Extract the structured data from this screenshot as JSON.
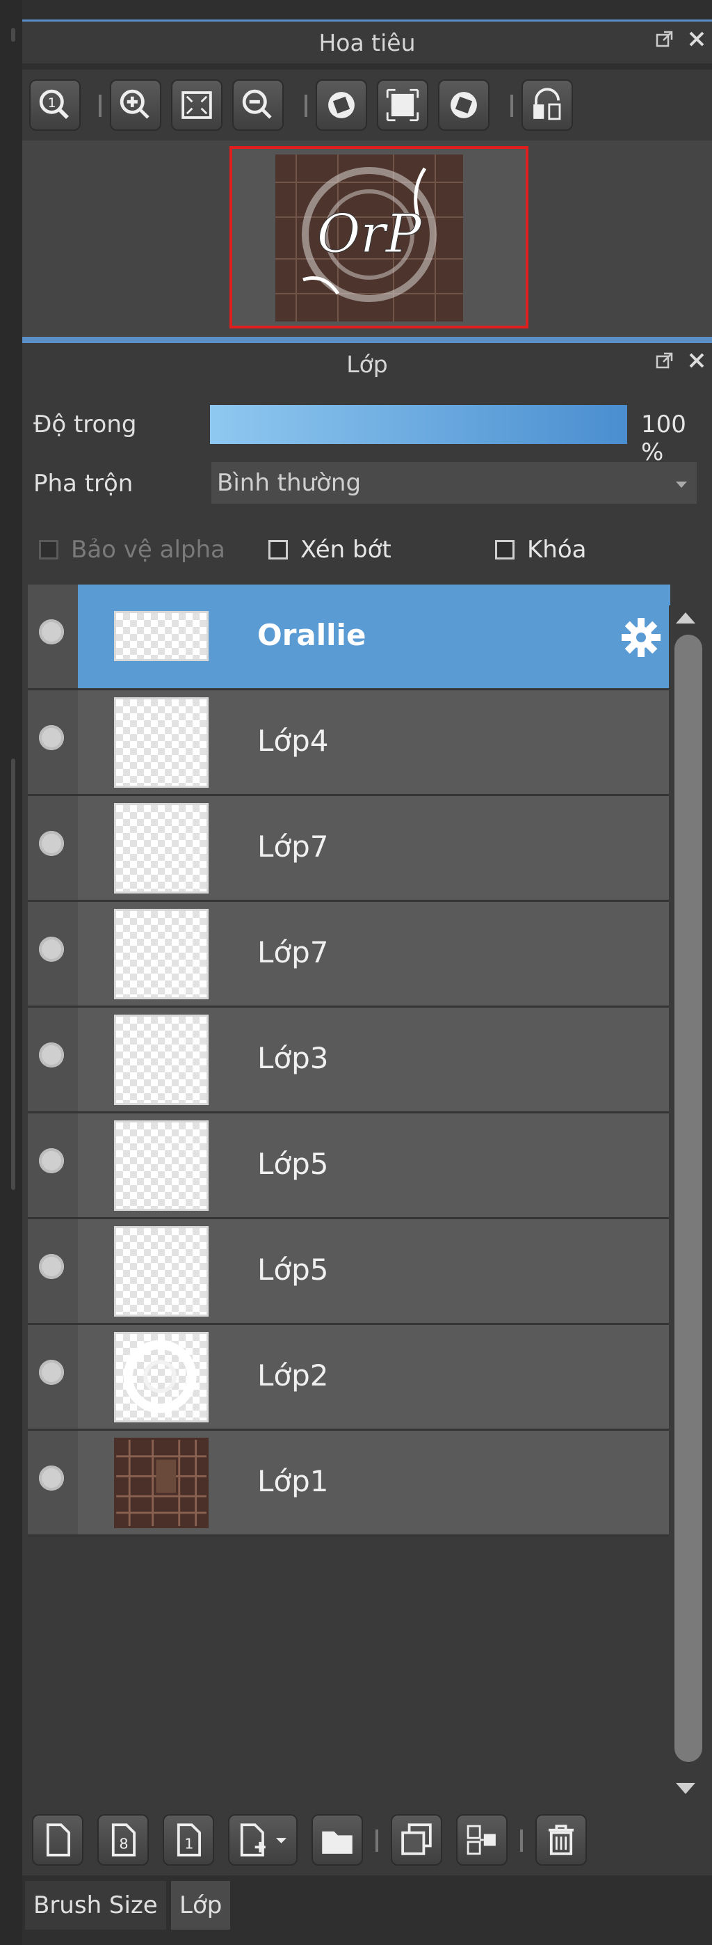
{
  "navigator": {
    "title": "Hoa tiêu",
    "tools": [
      "zoom-actual-icon",
      "zoom-in-icon",
      "fit-screen-icon",
      "zoom-out-icon",
      "rotate-left-icon",
      "fit-window-icon",
      "rotate-right-icon",
      "flip-horizontal-icon"
    ],
    "preview_text": "OrP"
  },
  "layers": {
    "title": "Lớp",
    "opacity_label": "Độ trong",
    "opacity_value": "100 %",
    "opacity_fraction": 1.0,
    "blend_label": "Pha trộn",
    "blend_value": "Bình thường",
    "checkboxes": {
      "protect_alpha": "Bảo vệ alpha",
      "clip": "Xén bớt",
      "lock": "Khóa"
    },
    "items": [
      {
        "name": "Orallie",
        "selected": true
      },
      {
        "name": "Lớp4"
      },
      {
        "name": "Lớp7"
      },
      {
        "name": "Lớp7"
      },
      {
        "name": "Lớp3"
      },
      {
        "name": "Lớp5"
      },
      {
        "name": "Lớp5"
      },
      {
        "name": "Lớp2"
      },
      {
        "name": "Lớp1"
      }
    ]
  },
  "layer_tools": [
    "new-layer-icon",
    "new-8bit-layer-icon",
    "new-1bit-layer-icon",
    "add-layer-menu-icon",
    "new-folder-icon",
    "duplicate-layer-icon",
    "merge-down-icon",
    "delete-layer-icon"
  ],
  "bottom_tabs": {
    "brush_size": "Brush Size",
    "layer": "Lớp"
  },
  "colors": {
    "accent": "#5a9bd4",
    "panel": "#3a3a3a",
    "row": "#5a5a5a",
    "preview_border": "#e01e1e"
  }
}
